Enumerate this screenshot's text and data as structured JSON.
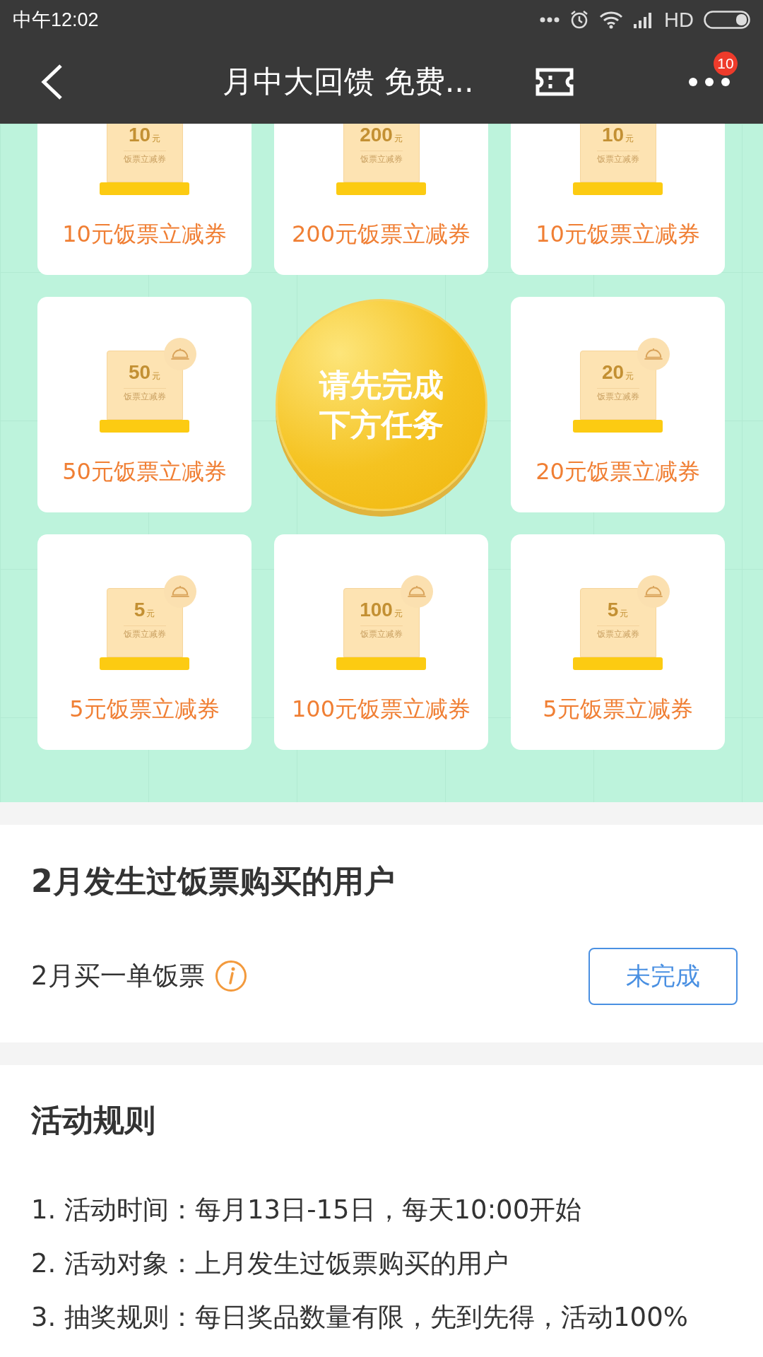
{
  "status_bar": {
    "time": "中午12:02",
    "network": "HD"
  },
  "nav": {
    "title": "月中大回馈 免费...",
    "badge": "10"
  },
  "prize_grid": [
    {
      "kind": "coupon",
      "amount": "10",
      "unit": "元",
      "subtitle": "饭票立减券",
      "label": "10元饭票立减券"
    },
    {
      "kind": "coupon",
      "amount": "200",
      "unit": "元",
      "subtitle": "饭票立减券",
      "label": "200元饭票立减券"
    },
    {
      "kind": "coupon",
      "amount": "10",
      "unit": "元",
      "subtitle": "饭票立减券",
      "label": "10元饭票立减券"
    },
    {
      "kind": "coupon",
      "amount": "50",
      "unit": "元",
      "subtitle": "饭票立减券",
      "label": "50元饭票立减券"
    },
    {
      "kind": "coin",
      "lines": [
        "请先完成",
        "下方任务"
      ]
    },
    {
      "kind": "coupon",
      "amount": "20",
      "unit": "元",
      "subtitle": "饭票立减券",
      "label": "20元饭票立减券"
    },
    {
      "kind": "coupon",
      "amount": "5",
      "unit": "元",
      "subtitle": "饭票立减券",
      "label": "5元饭票立减券"
    },
    {
      "kind": "coupon",
      "amount": "100",
      "unit": "元",
      "subtitle": "饭票立减券",
      "label": "100元饭票立减券"
    },
    {
      "kind": "coupon",
      "amount": "5",
      "unit": "元",
      "subtitle": "饭票立减券",
      "label": "5元饭票立减券"
    }
  ],
  "task_section": {
    "title": "2月发生过饭票购买的用户",
    "task": "2月买一单饭票",
    "button": "未完成"
  },
  "rules": {
    "title": "活动规则",
    "items": [
      "1. 活动时间：每月13日-15日，每天10:00开始",
      "2. 活动对象：上月发生过饭票购买的用户",
      "3. 抽奖规则：每日奖品数量有限，先到先得，活动100%"
    ]
  }
}
